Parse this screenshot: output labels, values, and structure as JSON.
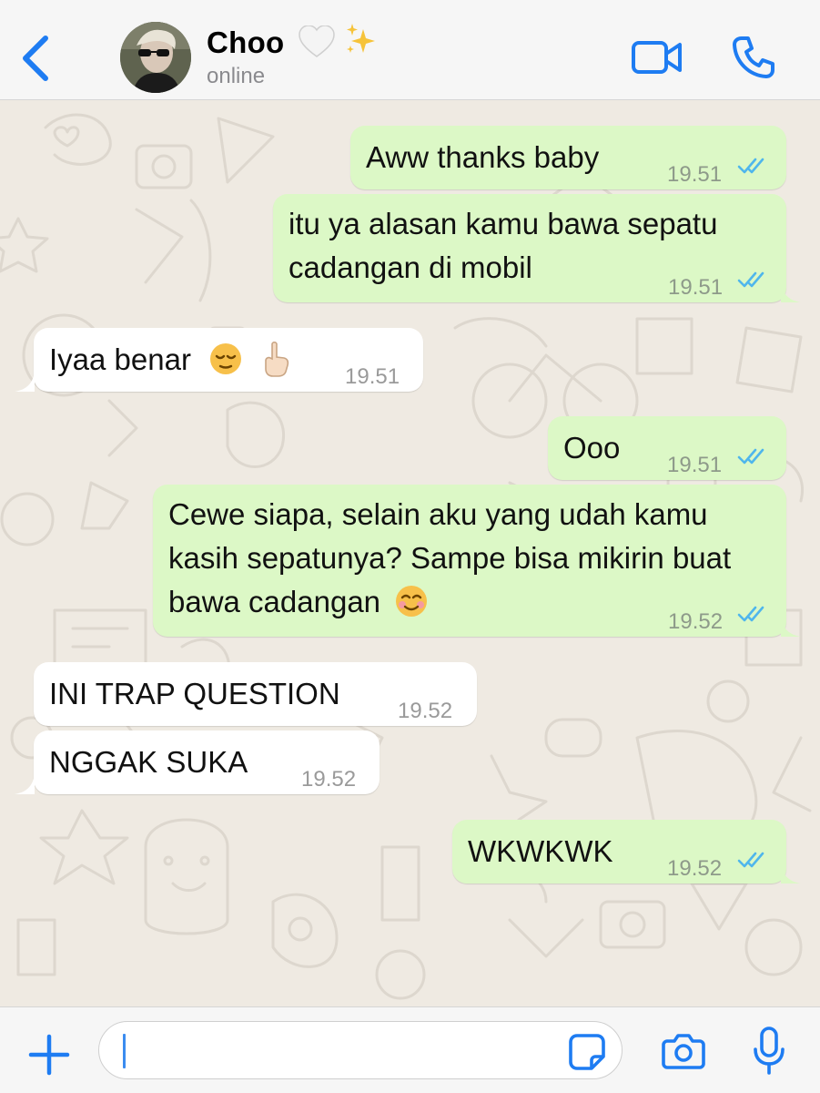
{
  "header": {
    "contact_name": "Choo",
    "contact_status": "online",
    "back_icon": "chevron-left-icon",
    "video_icon": "video-camera-icon",
    "call_icon": "phone-icon",
    "name_emojis": [
      "white-heart",
      "sparkles"
    ]
  },
  "messages": [
    {
      "direction": "outgoing",
      "text": "Aww thanks baby",
      "time": "19.51",
      "status": "read"
    },
    {
      "direction": "outgoing",
      "text": "itu ya alasan kamu bawa sepatu cadangan di mobil",
      "time": "19.51",
      "status": "read"
    },
    {
      "direction": "incoming",
      "text": "Iyaa benar",
      "emojis": [
        "relieved-face",
        "index-pointing-up"
      ],
      "time": "19.51"
    },
    {
      "direction": "outgoing",
      "text": "Ooo",
      "time": "19.51",
      "status": "read"
    },
    {
      "direction": "outgoing",
      "text": "Cewe siapa, selain aku yang udah kamu kasih sepatunya? Sampe bisa mikirin buat bawa cadangan",
      "emojis": [
        "smiling-face"
      ],
      "time": "19.52",
      "status": "read"
    },
    {
      "direction": "incoming",
      "text": "INI TRAP QUESTION",
      "time": "19.52"
    },
    {
      "direction": "incoming",
      "text": "NGGAK SUKA",
      "time": "19.52"
    },
    {
      "direction": "outgoing",
      "text": "WKWKWK",
      "time": "19.52",
      "status": "read"
    }
  ],
  "input": {
    "placeholder": "",
    "value": "",
    "icons": [
      "plus-icon",
      "sticker-icon",
      "camera-icon",
      "microphone-icon"
    ]
  },
  "colors": {
    "accent": "#1e7cf2",
    "outgoing_bubble": "#dcf8c6",
    "incoming_bubble": "#ffffff",
    "chat_background": "#efeae2",
    "read_ticks": "#4fb6ec"
  }
}
